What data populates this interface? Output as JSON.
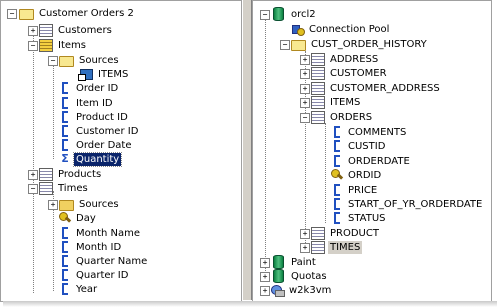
{
  "left_tree": {
    "root": "Customer Orders 2",
    "customers": "Customers",
    "items": "Items",
    "sources": "Sources",
    "items_source": "ITEMS",
    "order_id": "Order ID",
    "item_id": "Item ID",
    "product_id": "Product ID",
    "customer_id": "Customer ID",
    "order_date": "Order Date",
    "quantity": "Quantity",
    "products": "Products",
    "times": "Times",
    "times_sources": "Sources",
    "day": "Day",
    "month_name": "Month Name",
    "month_id": "Month ID",
    "quarter_name": "Quarter Name",
    "quarter_id": "Quarter ID",
    "year": "Year"
  },
  "right_tree": {
    "orcl2": "orcl2",
    "connection_pool": "Connection Pool",
    "schema": "CUST_ORDER_HISTORY",
    "address": "ADDRESS",
    "customer": "CUSTOMER",
    "customer_address": "CUSTOMER_ADDRESS",
    "items": "ITEMS",
    "orders": "ORDERS",
    "comments": "COMMENTS",
    "custid": "CUSTID",
    "orderdate": "ORDERDATE",
    "ordid": "ORDID",
    "price": "PRICE",
    "start_of_yr": "START_OF_YR_ORDERDATE",
    "status": "STATUS",
    "product": "PRODUCT",
    "times": "TIMES",
    "paint": "Paint",
    "quotas": "Quotas",
    "w2k3vm": "w2k3vm"
  },
  "expander": {
    "plus": "+",
    "minus": "−"
  },
  "sigma": "Σ"
}
